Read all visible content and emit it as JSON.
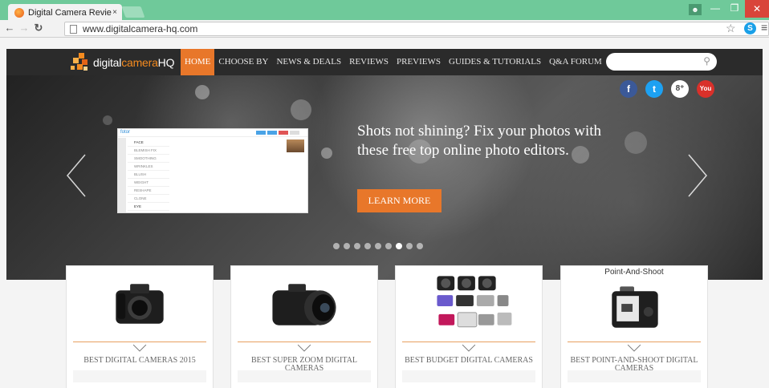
{
  "browser": {
    "tab_title": "Digital Camera Revie",
    "tab_close": "×",
    "url": "www.digitalcamera-hq.com"
  },
  "site": {
    "logo": {
      "prefix": "digital",
      "brand": "camera",
      "suffix": "HQ"
    },
    "nav": [
      "HOME",
      "CHOOSE BY",
      "NEWS & DEALS",
      "REVIEWS",
      "PREVIEWS",
      "GUIDES & TUTORIALS",
      "Q&A FORUM"
    ],
    "social": [
      "f",
      "t",
      "8⁺",
      "You"
    ],
    "hero": {
      "headline": "Shots not shining? Fix your photos with these free top online photo editors.",
      "cta": "LEARN MORE",
      "screenshot": {
        "app_name": "fotor",
        "menu": [
          "FACE",
          "BLEMISH FIX",
          "SMOOTHING",
          "WRINKLES",
          "BLUSH",
          "WEIGHT",
          "RESHAPE",
          "CLONE",
          "EYE"
        ]
      },
      "slide_count": 9,
      "active_slide": 7
    },
    "cards": [
      {
        "label": "BEST DIGITAL CAMERAS 2015",
        "image_title": ""
      },
      {
        "label": "BEST SUPER ZOOM DIGITAL CAMERAS",
        "image_title": ""
      },
      {
        "label": "BEST BUDGET DIGITAL CAMERAS",
        "image_title": ""
      },
      {
        "label": "BEST POINT-AND-SHOOT DIGITAL CAMERAS",
        "image_title": "Point-And-Shoot"
      }
    ]
  }
}
